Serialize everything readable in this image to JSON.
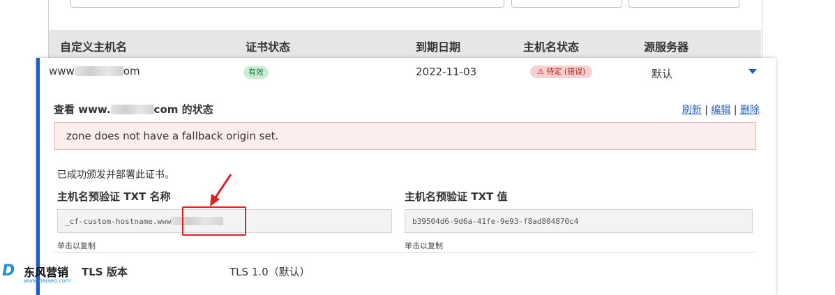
{
  "table": {
    "headers": [
      "自定义主机名",
      "证书状态",
      "到期日期",
      "主机名状态",
      "源服务器"
    ],
    "row": {
      "hostname_prefix": "www",
      "hostname_suffix": "om",
      "cert_status": "有效",
      "expiry": "2022-11-03",
      "hostname_status": "⚠ 待定 (错误)",
      "origin": "默认"
    }
  },
  "detail": {
    "title_prefix": "查看 www.",
    "title_suffix": "com 的状态",
    "actions": {
      "refresh": "刷新",
      "edit": "编辑",
      "delete": "删除",
      "separator": "|"
    },
    "error_message": "zone does not have a fallback origin set.",
    "issued_text": "已成功颁发并部署此证书。",
    "txt_name": {
      "label": "主机名预验证 TXT 名称",
      "value": "_cf-custom-hostname.www",
      "hint": "单击以复制"
    },
    "txt_value": {
      "label": "主机名预验证 TXT 值",
      "value": "b39504d6-9d6a-41fe-9e93-f8ad804870c4",
      "hint": "单击以复制"
    },
    "tls": {
      "label": "TLS 版本",
      "value": "TLS 1.0（默认）"
    }
  },
  "watermark": {
    "name": "东风营销",
    "url": "www.baiseo.com"
  },
  "colors": {
    "accent": "#1f5fc5",
    "error_bg": "#fdeeee",
    "badge_ok": "#c9eed5",
    "badge_err": "#f9d0d0",
    "highlight": "#e02020"
  }
}
